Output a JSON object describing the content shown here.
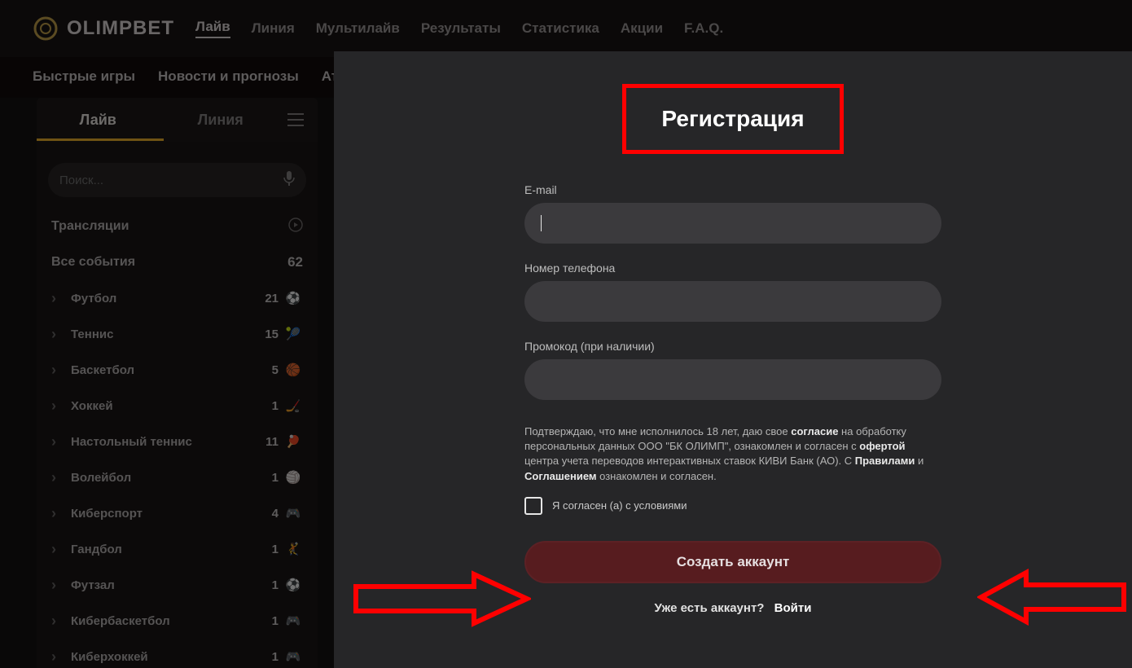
{
  "brand": "OLIMPBET",
  "nav": {
    "items": [
      "Лайв",
      "Линия",
      "Мультилайв",
      "Результаты",
      "Статистика",
      "Акции",
      "F.A.Q."
    ],
    "active_index": 0
  },
  "secondary_nav": [
    "Быстрые игры",
    "Новости и прогнозы",
    "Аталанта"
  ],
  "sidebar": {
    "tabs": {
      "live": "Лайв",
      "line": "Линия"
    },
    "search_placeholder": "Поиск...",
    "streams_label": "Трансляции",
    "all_events_label": "Все события",
    "all_events_count": "62",
    "sports": [
      {
        "name": "Футбол",
        "count": "21",
        "icon": "⚽"
      },
      {
        "name": "Теннис",
        "count": "15",
        "icon": "🎾"
      },
      {
        "name": "Баскетбол",
        "count": "5",
        "icon": "🏀"
      },
      {
        "name": "Хоккей",
        "count": "1",
        "icon": "🏒"
      },
      {
        "name": "Настольный теннис",
        "count": "11",
        "icon": "🏓"
      },
      {
        "name": "Волейбол",
        "count": "1",
        "icon": "🏐"
      },
      {
        "name": "Киберспорт",
        "count": "4",
        "icon": "🎮"
      },
      {
        "name": "Гандбол",
        "count": "1",
        "icon": "🤾"
      },
      {
        "name": "Футзал",
        "count": "1",
        "icon": "⚽"
      },
      {
        "name": "Кибербаскетбол",
        "count": "1",
        "icon": "🎮"
      },
      {
        "name": "Киберхоккей",
        "count": "1",
        "icon": "🎮"
      }
    ]
  },
  "modal": {
    "title": "Регистрация",
    "email_label": "E-mail",
    "email_value": "",
    "phone_label": "Номер телефона",
    "phone_value": "",
    "promo_label": "Промокод (при наличии)",
    "promo_value": "",
    "legal_text_1": "Подтверждаю, что мне исполнилось 18 лет, даю свое ",
    "legal_link_consent": "согласие",
    "legal_text_2": " на обработку персональных данных ООО \"БК ОЛИМП\", ознакомлен и согласен с ",
    "legal_link_offer": "офертой",
    "legal_text_3": " центра учета переводов интерактивных ставок КИВИ Банк (АО). С ",
    "legal_link_rules": "Правилами",
    "legal_text_4": " и ",
    "legal_link_agreement": "Соглашением",
    "legal_text_5": " ознакомлен и согласен.",
    "agree_label": "Я согласен (а) с условиями",
    "create_btn": "Создать аккаунт",
    "already_text": "Уже есть аккаунт?",
    "login_link": "Войти"
  }
}
